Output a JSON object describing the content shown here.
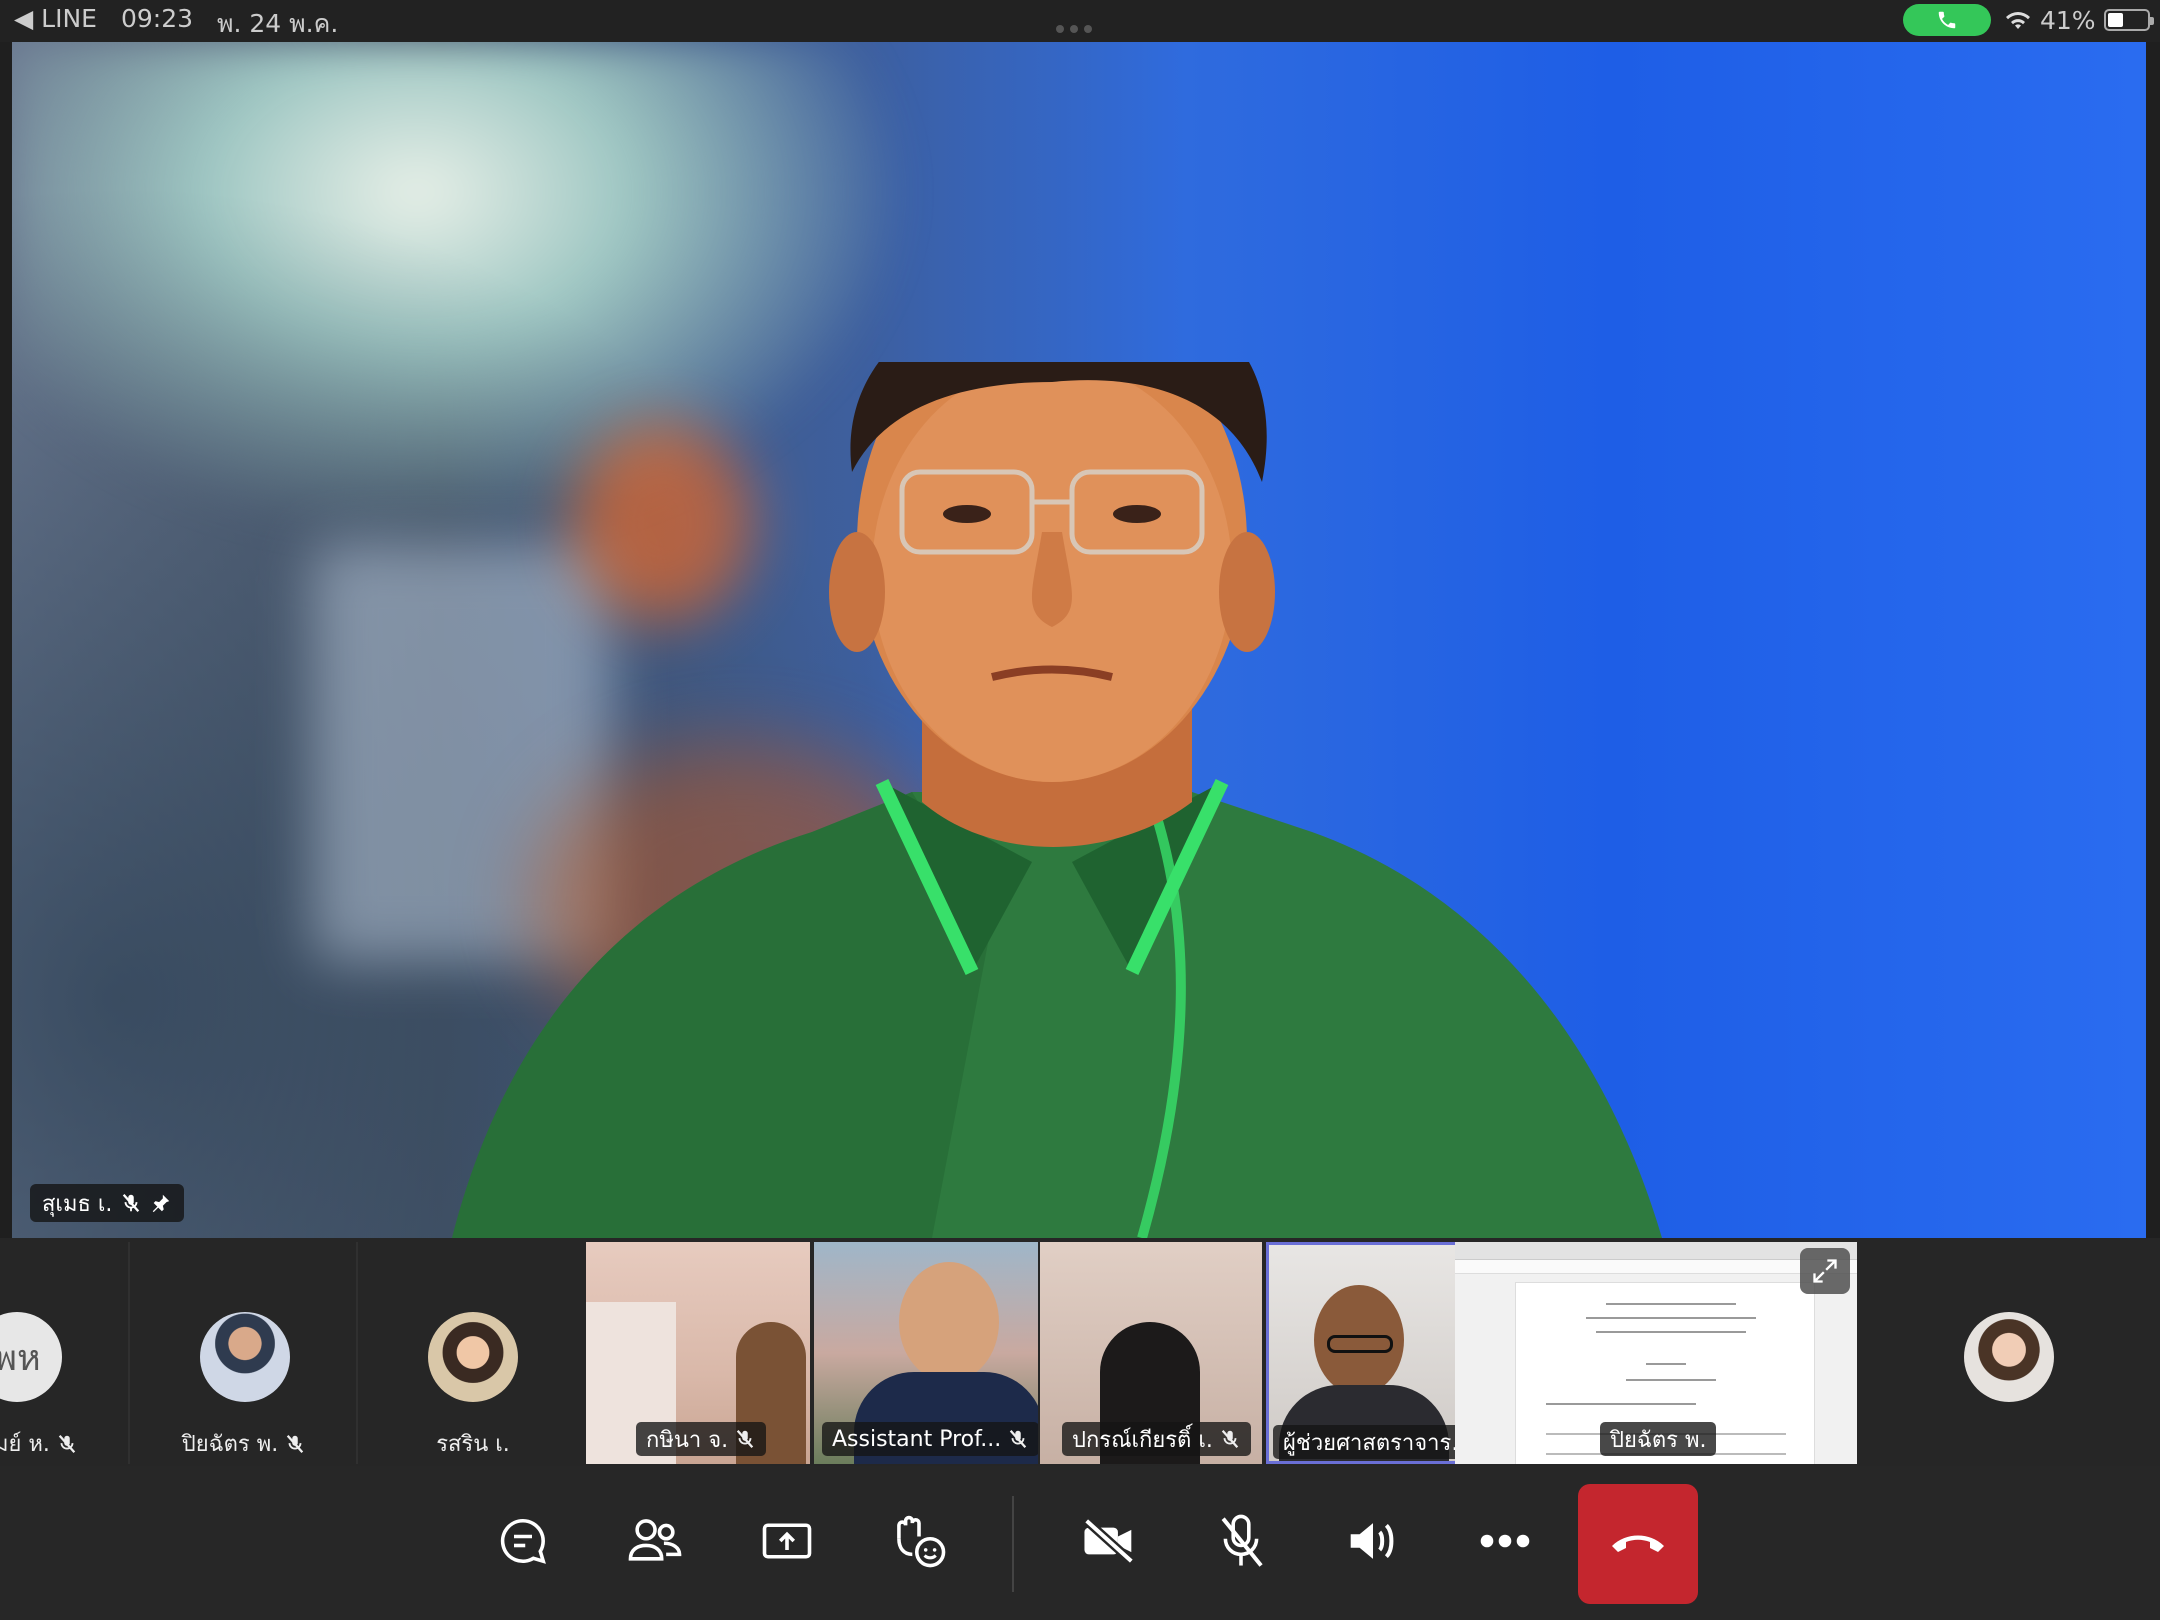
{
  "status_bar": {
    "back_app": "◀ LINE",
    "time": "09:23",
    "date": "พ. 24 พ.ค.",
    "battery": "41%",
    "battery_level": 0.41
  },
  "main_video": {
    "name": "สุเมธ เ."
  },
  "participants": [
    {
      "initials": "พห",
      "name": "มย์ ห."
    },
    {
      "name": "ปิยฉัตร พ."
    },
    {
      "name": "รสริน เ."
    }
  ],
  "video_tiles": [
    {
      "name": "กษินา จ."
    },
    {
      "name": "Assistant Prof..."
    },
    {
      "name": "ปกรณ์เกียรติ์ เ."
    },
    {
      "name": "ผู้ช่วยศาสตราจาร..."
    }
  ],
  "share_tile": {
    "name": "ปิยฉัตร พ."
  },
  "colors": {
    "call_green": "#34c759",
    "end_call_red": "#c4262e",
    "active_border": "#6a6fd6"
  },
  "toolbar": {
    "buttons": [
      "chat-icon",
      "people-icon",
      "share-screen-icon",
      "reactions-icon",
      "camera-off-icon",
      "mic-off-icon",
      "speaker-icon",
      "more-icon",
      "end-call-icon"
    ]
  }
}
